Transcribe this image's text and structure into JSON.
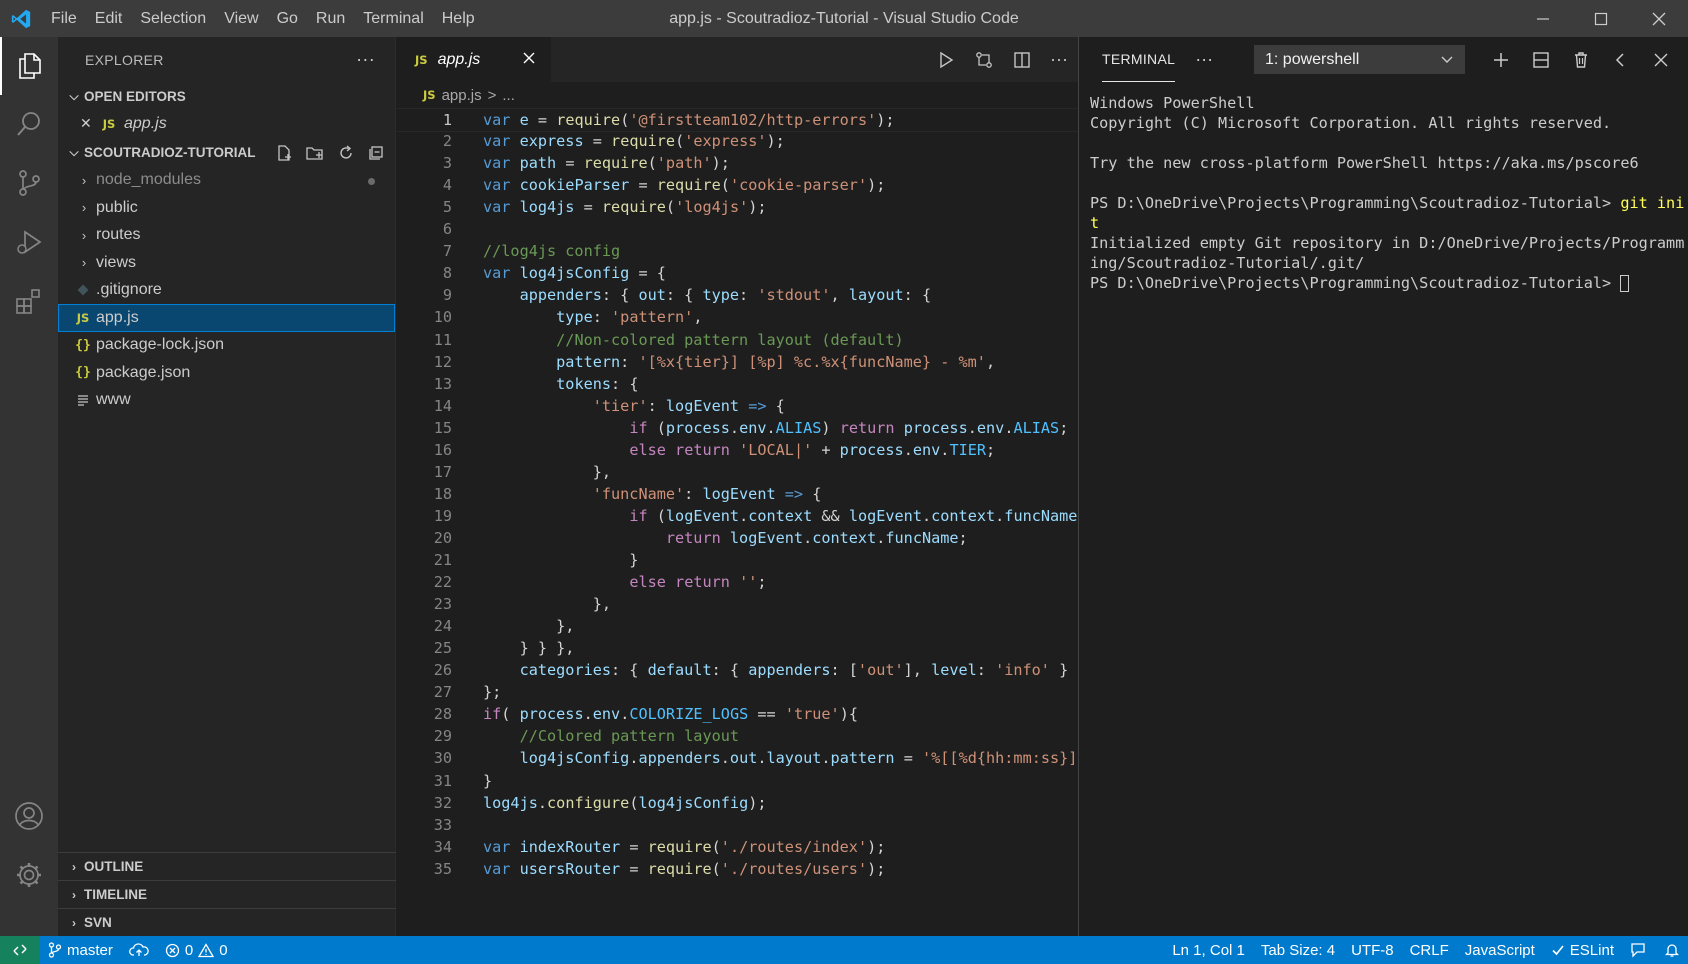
{
  "window": {
    "title": "app.js - Scoutradioz-Tutorial - Visual Studio Code",
    "menu": [
      "File",
      "Edit",
      "Selection",
      "View",
      "Go",
      "Run",
      "Terminal",
      "Help"
    ]
  },
  "colors": {
    "accent": "#007acc",
    "remote": "#16825d",
    "selection": "#094771"
  },
  "sidebar": {
    "title": "EXPLORER",
    "open_editors": {
      "label": "OPEN EDITORS",
      "files": [
        {
          "name": "app.js",
          "badge": "JS"
        }
      ]
    },
    "project": {
      "label": "SCOUTRADIOZ-TUTORIAL",
      "items": [
        {
          "name": "node_modules",
          "kind": "folder"
        },
        {
          "name": "public",
          "kind": "folder"
        },
        {
          "name": "routes",
          "kind": "folder"
        },
        {
          "name": "views",
          "kind": "folder"
        },
        {
          "name": ".gitignore",
          "kind": "git"
        },
        {
          "name": "app.js",
          "kind": "js"
        },
        {
          "name": "package-lock.json",
          "kind": "json"
        },
        {
          "name": "package.json",
          "kind": "json"
        },
        {
          "name": "www",
          "kind": "text"
        }
      ]
    },
    "bottom_sections": [
      "OUTLINE",
      "TIMELINE",
      "SVN"
    ]
  },
  "editor": {
    "tab": {
      "label": "app.js",
      "badge": "JS"
    },
    "breadcrumb": {
      "file": "app.js",
      "separator": ">",
      "tail": "..."
    },
    "lines": [
      [
        [
          "kw",
          "var"
        ],
        [
          "pu",
          " "
        ],
        [
          "var",
          "e"
        ],
        [
          "pu",
          " = "
        ],
        [
          "fn",
          "require"
        ],
        [
          "pu",
          "("
        ],
        [
          "str",
          "'@firstteam102/http-errors'"
        ],
        [
          "pu",
          ");"
        ]
      ],
      [
        [
          "kw",
          "var"
        ],
        [
          "pu",
          " "
        ],
        [
          "var",
          "express"
        ],
        [
          "pu",
          " = "
        ],
        [
          "fn",
          "require"
        ],
        [
          "pu",
          "("
        ],
        [
          "str",
          "'express'"
        ],
        [
          "pu",
          ");"
        ]
      ],
      [
        [
          "kw",
          "var"
        ],
        [
          "pu",
          " "
        ],
        [
          "var",
          "path"
        ],
        [
          "pu",
          " = "
        ],
        [
          "fn",
          "require"
        ],
        [
          "pu",
          "("
        ],
        [
          "str",
          "'path'"
        ],
        [
          "pu",
          ");"
        ]
      ],
      [
        [
          "kw",
          "var"
        ],
        [
          "pu",
          " "
        ],
        [
          "var",
          "cookieParser"
        ],
        [
          "pu",
          " = "
        ],
        [
          "fn",
          "require"
        ],
        [
          "pu",
          "("
        ],
        [
          "str",
          "'cookie-parser'"
        ],
        [
          "pu",
          ");"
        ]
      ],
      [
        [
          "kw",
          "var"
        ],
        [
          "pu",
          " "
        ],
        [
          "var",
          "log4js"
        ],
        [
          "pu",
          " = "
        ],
        [
          "fn",
          "require"
        ],
        [
          "pu",
          "("
        ],
        [
          "str",
          "'log4js'"
        ],
        [
          "pu",
          ");"
        ]
      ],
      [],
      [
        [
          "cm",
          "//log4js config"
        ]
      ],
      [
        [
          "kw",
          "var"
        ],
        [
          "pu",
          " "
        ],
        [
          "var",
          "log4jsConfig"
        ],
        [
          "pu",
          " = {"
        ]
      ],
      [
        [
          "pu",
          "    "
        ],
        [
          "var",
          "appenders"
        ],
        [
          "pu",
          ": { "
        ],
        [
          "var",
          "out"
        ],
        [
          "pu",
          ": { "
        ],
        [
          "var",
          "type"
        ],
        [
          "pu",
          ": "
        ],
        [
          "str",
          "'stdout'"
        ],
        [
          "pu",
          ", "
        ],
        [
          "var",
          "layout"
        ],
        [
          "pu",
          ": {"
        ]
      ],
      [
        [
          "pu",
          "        "
        ],
        [
          "var",
          "type"
        ],
        [
          "pu",
          ": "
        ],
        [
          "str",
          "'pattern'"
        ],
        [
          "pu",
          ","
        ]
      ],
      [
        [
          "pu",
          "        "
        ],
        [
          "cm",
          "//Non-colored pattern layout (default)"
        ]
      ],
      [
        [
          "pu",
          "        "
        ],
        [
          "var",
          "pattern"
        ],
        [
          "pu",
          ": "
        ],
        [
          "str",
          "'[%x{tier}] [%p] %c.%x{funcName} - %m'"
        ],
        [
          "pu",
          ","
        ]
      ],
      [
        [
          "pu",
          "        "
        ],
        [
          "var",
          "tokens"
        ],
        [
          "pu",
          ": {"
        ]
      ],
      [
        [
          "pu",
          "            "
        ],
        [
          "str",
          "'tier'"
        ],
        [
          "pu",
          ": "
        ],
        [
          "var",
          "logEvent"
        ],
        [
          "pu",
          " "
        ],
        [
          "kw",
          "=>"
        ],
        [
          "pu",
          " {"
        ]
      ],
      [
        [
          "pu",
          "                "
        ],
        [
          "kw2",
          "if"
        ],
        [
          "pu",
          " ("
        ],
        [
          "var",
          "process"
        ],
        [
          "pu",
          "."
        ],
        [
          "var",
          "env"
        ],
        [
          "pu",
          "."
        ],
        [
          "cn",
          "ALIAS"
        ],
        [
          "pu",
          ") "
        ],
        [
          "kw2",
          "return"
        ],
        [
          "pu",
          " "
        ],
        [
          "var",
          "process"
        ],
        [
          "pu",
          "."
        ],
        [
          "var",
          "env"
        ],
        [
          "pu",
          "."
        ],
        [
          "cn",
          "ALIAS"
        ],
        [
          "pu",
          ";"
        ]
      ],
      [
        [
          "pu",
          "                "
        ],
        [
          "kw2",
          "else"
        ],
        [
          "pu",
          " "
        ],
        [
          "kw2",
          "return"
        ],
        [
          "pu",
          " "
        ],
        [
          "str",
          "'LOCAL|'"
        ],
        [
          "pu",
          " + "
        ],
        [
          "var",
          "process"
        ],
        [
          "pu",
          "."
        ],
        [
          "var",
          "env"
        ],
        [
          "pu",
          "."
        ],
        [
          "cn",
          "TIER"
        ],
        [
          "pu",
          ";"
        ]
      ],
      [
        [
          "pu",
          "            },"
        ]
      ],
      [
        [
          "pu",
          "            "
        ],
        [
          "str",
          "'funcName'"
        ],
        [
          "pu",
          ": "
        ],
        [
          "var",
          "logEvent"
        ],
        [
          "pu",
          " "
        ],
        [
          "kw",
          "=>"
        ],
        [
          "pu",
          " {"
        ]
      ],
      [
        [
          "pu",
          "                "
        ],
        [
          "kw2",
          "if"
        ],
        [
          "pu",
          " ("
        ],
        [
          "var",
          "logEvent"
        ],
        [
          "pu",
          "."
        ],
        [
          "var",
          "context"
        ],
        [
          "pu",
          " && "
        ],
        [
          "var",
          "logEvent"
        ],
        [
          "pu",
          "."
        ],
        [
          "var",
          "context"
        ],
        [
          "pu",
          "."
        ],
        [
          "var",
          "funcName"
        ],
        [
          "pu",
          ")"
        ]
      ],
      [
        [
          "pu",
          "                    "
        ],
        [
          "kw2",
          "return"
        ],
        [
          "pu",
          " "
        ],
        [
          "var",
          "logEvent"
        ],
        [
          "pu",
          "."
        ],
        [
          "var",
          "context"
        ],
        [
          "pu",
          "."
        ],
        [
          "var",
          "funcName"
        ],
        [
          "pu",
          ";"
        ]
      ],
      [
        [
          "pu",
          "                }"
        ]
      ],
      [
        [
          "pu",
          "                "
        ],
        [
          "kw2",
          "else"
        ],
        [
          "pu",
          " "
        ],
        [
          "kw2",
          "return"
        ],
        [
          "pu",
          " "
        ],
        [
          "str",
          "''"
        ],
        [
          "pu",
          ";"
        ]
      ],
      [
        [
          "pu",
          "            },"
        ]
      ],
      [
        [
          "pu",
          "        },"
        ]
      ],
      [
        [
          "pu",
          "    } } },"
        ]
      ],
      [
        [
          "pu",
          "    "
        ],
        [
          "var",
          "categories"
        ],
        [
          "pu",
          ": { "
        ],
        [
          "var",
          "default"
        ],
        [
          "pu",
          ": { "
        ],
        [
          "var",
          "appenders"
        ],
        [
          "pu",
          ": ["
        ],
        [
          "str",
          "'out'"
        ],
        [
          "pu",
          "], "
        ],
        [
          "var",
          "level"
        ],
        [
          "pu",
          ": "
        ],
        [
          "str",
          "'info'"
        ],
        [
          "pu",
          " } }"
        ]
      ],
      [
        [
          "pu",
          "};"
        ]
      ],
      [
        [
          "kw2",
          "if"
        ],
        [
          "pu",
          "( "
        ],
        [
          "var",
          "process"
        ],
        [
          "pu",
          "."
        ],
        [
          "var",
          "env"
        ],
        [
          "pu",
          "."
        ],
        [
          "cn",
          "COLORIZE_LOGS"
        ],
        [
          "pu",
          " == "
        ],
        [
          "str",
          "'true'"
        ],
        [
          "pu",
          "){"
        ]
      ],
      [
        [
          "pu",
          "    "
        ],
        [
          "cm",
          "//Colored pattern layout"
        ]
      ],
      [
        [
          "pu",
          "    "
        ],
        [
          "var",
          "log4jsConfig"
        ],
        [
          "pu",
          "."
        ],
        [
          "var",
          "appenders"
        ],
        [
          "pu",
          "."
        ],
        [
          "var",
          "out"
        ],
        [
          "pu",
          "."
        ],
        [
          "var",
          "layout"
        ],
        [
          "pu",
          "."
        ],
        [
          "var",
          "pattern"
        ],
        [
          "pu",
          " = "
        ],
        [
          "str",
          "'%[[%d{hh:mm:ss}]"
        ]
      ],
      [
        [
          "pu",
          "}"
        ]
      ],
      [
        [
          "var",
          "log4js"
        ],
        [
          "pu",
          "."
        ],
        [
          "fn",
          "configure"
        ],
        [
          "pu",
          "("
        ],
        [
          "var",
          "log4jsConfig"
        ],
        [
          "pu",
          ");"
        ]
      ],
      [],
      [
        [
          "kw",
          "var"
        ],
        [
          "pu",
          " "
        ],
        [
          "var",
          "indexRouter"
        ],
        [
          "pu",
          " = "
        ],
        [
          "fn",
          "require"
        ],
        [
          "pu",
          "("
        ],
        [
          "str",
          "'./routes/index'"
        ],
        [
          "pu",
          ");"
        ]
      ],
      [
        [
          "kw",
          "var"
        ],
        [
          "pu",
          " "
        ],
        [
          "var",
          "usersRouter"
        ],
        [
          "pu",
          " = "
        ],
        [
          "fn",
          "require"
        ],
        [
          "pu",
          "("
        ],
        [
          "str",
          "'./routes/users'"
        ],
        [
          "pu",
          ");"
        ]
      ]
    ]
  },
  "terminal": {
    "tab_label": "TERMINAL",
    "shell_select": "1: powershell",
    "lines": [
      [
        [
          "plain",
          "Windows PowerShell"
        ]
      ],
      [
        [
          "plain",
          "Copyright (C) Microsoft Corporation. All rights reserved."
        ]
      ],
      [],
      [
        [
          "plain",
          "Try the new cross-platform PowerShell https://aka.ms/pscore6"
        ]
      ],
      [],
      [
        [
          "plain",
          "PS D:\\OneDrive\\Projects\\Programming\\Scoutradioz-Tutorial> "
        ],
        [
          "yl",
          "git ini"
        ]
      ],
      [
        [
          "yl",
          "t"
        ]
      ],
      [
        [
          "plain",
          "Initialized empty Git repository in D:/OneDrive/Projects/Programm"
        ]
      ],
      [
        [
          "plain",
          "ing/Scoutradioz-Tutorial/.git/"
        ]
      ],
      [
        [
          "plain",
          "PS D:\\OneDrive\\Projects\\Programming\\Scoutradioz-Tutorial> "
        ],
        [
          "cursor",
          ""
        ]
      ]
    ]
  },
  "statusbar": {
    "branch": "master",
    "errors": "0",
    "warnings": "0",
    "position": "Ln 1, Col 1",
    "tab_size": "Tab Size: 4",
    "encoding": "UTF-8",
    "eol": "CRLF",
    "language": "JavaScript",
    "linter": "ESLint"
  }
}
